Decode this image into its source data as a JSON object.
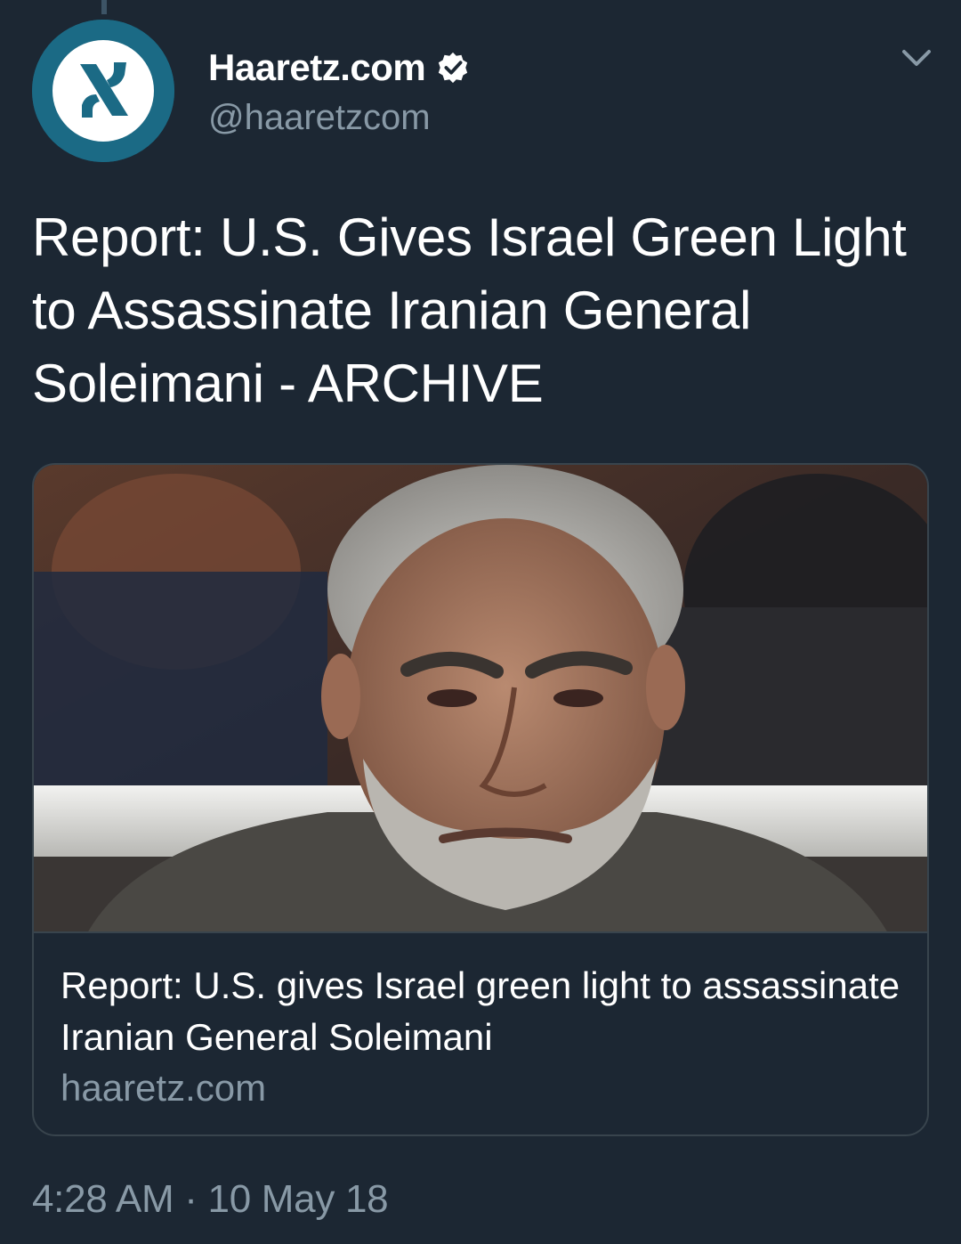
{
  "author": {
    "display_name": "Haaretz.com",
    "handle": "@haaretzcom",
    "verified": true,
    "avatar_icon": "haaretz-logo-icon"
  },
  "menu_icon": "chevron-down-icon",
  "tweet": {
    "text": "Report: U.S. Gives Israel Green Light to Assassinate Iranian General Soleimani - ARCHIVE"
  },
  "card": {
    "image_alt": "Photo of Qassem Soleimani",
    "title": "Report: U.S. gives Israel green light to assassinate Iranian General Soleimani",
    "domain": "haaretz.com"
  },
  "meta": {
    "timestamp": "4:28 AM · 10 May 18"
  },
  "colors": {
    "background": "#1c2733",
    "secondary_text": "#8899a6",
    "avatar_ring": "#1b6a85",
    "border": "#38444d"
  }
}
